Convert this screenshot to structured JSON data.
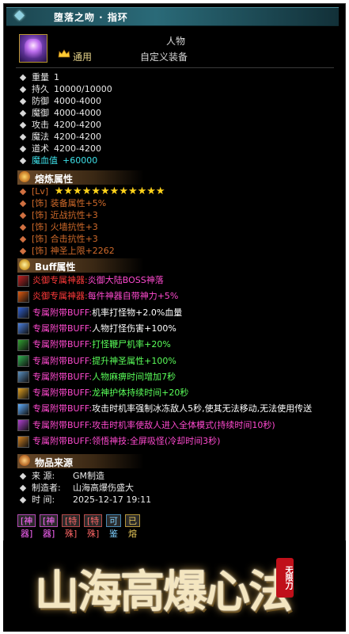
{
  "window": {
    "title": "堕落之吻 · 指环",
    "close_label": "×"
  },
  "item": {
    "icon": "ring-item-icon",
    "category": "通用",
    "type_line1": "人物",
    "type_line2": "自定义装备"
  },
  "stats": [
    {
      "label": "重量",
      "value": "1"
    },
    {
      "label": "持久",
      "value": "10000/10000"
    },
    {
      "label": "防御",
      "value": "4000-4000"
    },
    {
      "label": "魔御",
      "value": "4000-4000"
    },
    {
      "label": "攻击",
      "value": "4200-4200"
    },
    {
      "label": "魔法",
      "value": "4200-4200"
    },
    {
      "label": "道术",
      "value": "4200-4200"
    },
    {
      "label": "魔血值",
      "value": "+60000",
      "highlight": true
    }
  ],
  "refine": {
    "header": "熔炼属性",
    "level_tag": "[Lv]",
    "stars": "★★★★★★★★★★★★",
    "star_count": 12,
    "lines": [
      {
        "tag": "[饰]",
        "name": "装备属性",
        "value": "+5%"
      },
      {
        "tag": "[饰]",
        "name": "近战抗性",
        "value": "+3"
      },
      {
        "tag": "[饰]",
        "name": "火墙抗性",
        "value": "+3"
      },
      {
        "tag": "[饰]",
        "name": "合击抗性",
        "value": "+3"
      },
      {
        "tag": "[饰]",
        "name": "神圣上限",
        "value": "+2262"
      }
    ]
  },
  "buff": {
    "header": "Buff属性",
    "lines": [
      {
        "prefix": "炎御专属神器:",
        "text": "炎御大陆BOSS神落",
        "color": "#ff4ad0",
        "prefix_color": "#ff3a3a",
        "icon": "sword-red-icon"
      },
      {
        "prefix": "炎御专属神器:",
        "text": "每件神器自带神力+5%",
        "color": "#ff4ad0",
        "prefix_color": "#ff3a3a",
        "icon": "sword-orange-icon"
      },
      {
        "prefix": "专属附带BUFF:",
        "text": "机率打怪物+2.0%血量",
        "color": "#ffffff",
        "prefix_color": "#ff4ad0",
        "icon": "blue-gem-icon"
      },
      {
        "prefix": "专属附带BUFF:",
        "text": "人物打怪伤害+100%",
        "color": "#ffffff",
        "prefix_color": "#ff4ad0",
        "icon": "sword-blue-icon"
      },
      {
        "prefix": "专属附带BUFF:",
        "text": "打怪鞭尸机率+20%",
        "color": "#5aff5a",
        "prefix_color": "#ff4ad0",
        "icon": "green-blade-icon"
      },
      {
        "prefix": "专属附带BUFF:",
        "text": "提升神圣属性+100%",
        "color": "#5aff5a",
        "prefix_color": "#ff4ad0",
        "icon": "green-orb-icon"
      },
      {
        "prefix": "专属附带BUFF:",
        "text": "人物麻痹时间增加7秒",
        "color": "#5aff5a",
        "prefix_color": "#ff4ad0",
        "icon": "staff-icon"
      },
      {
        "prefix": "专属附带BUFF:",
        "text": "龙神护体持续时间+20秒",
        "color": "#5aff5a",
        "prefix_color": "#ff4ad0",
        "icon": "dragon-icon"
      },
      {
        "prefix": "专属附带BUFF:",
        "text": "攻击时机率强制冰冻敌人5秒,使其无法移动,无法使用传送",
        "color": "#ffffff",
        "prefix_color": "#ff4ad0",
        "icon": "ice-icon"
      },
      {
        "prefix": "专属附带BUFF:",
        "text": "攻击时机率使敌人进入全体模式(持续时间10秒)",
        "color": "#ff4ad0",
        "prefix_color": "#ff4ad0",
        "icon": "purple-swirl-icon"
      },
      {
        "prefix": "专属附带BUFF:",
        "text": "领悟神技:全屏吸怪(冷却时间3秒)",
        "color": "#ff4ad0",
        "prefix_color": "#ff4ad0",
        "icon": "blade-gold-icon"
      }
    ]
  },
  "source": {
    "header": "物品来源",
    "lines": [
      {
        "label": "来  源:",
        "value": "GM制造"
      },
      {
        "label": "制造者:",
        "value": "山海高爆伤盛大"
      },
      {
        "label": "时  间:",
        "value": "2025-12-17 19:11"
      }
    ]
  },
  "tags": [
    {
      "text": "[神器]",
      "color": "#ff66ff",
      "border": "#b44ab4"
    },
    {
      "text": "[神器]",
      "color": "#ff66ff",
      "border": "#b44ab4"
    },
    {
      "text": "[特殊]",
      "color": "#ff6666",
      "border": "#b44a4a"
    },
    {
      "text": "[特殊]",
      "color": "#ff6666",
      "border": "#b44a4a"
    },
    {
      "text": "可鉴定",
      "color": "#7fd0ff",
      "border": "#4a8ab4"
    },
    {
      "text": "已熔炼",
      "color": "#e6c65a",
      "border": "#b4963a"
    }
  ],
  "banner": {
    "title": "山海高爆心法",
    "seal": "无限刀"
  }
}
